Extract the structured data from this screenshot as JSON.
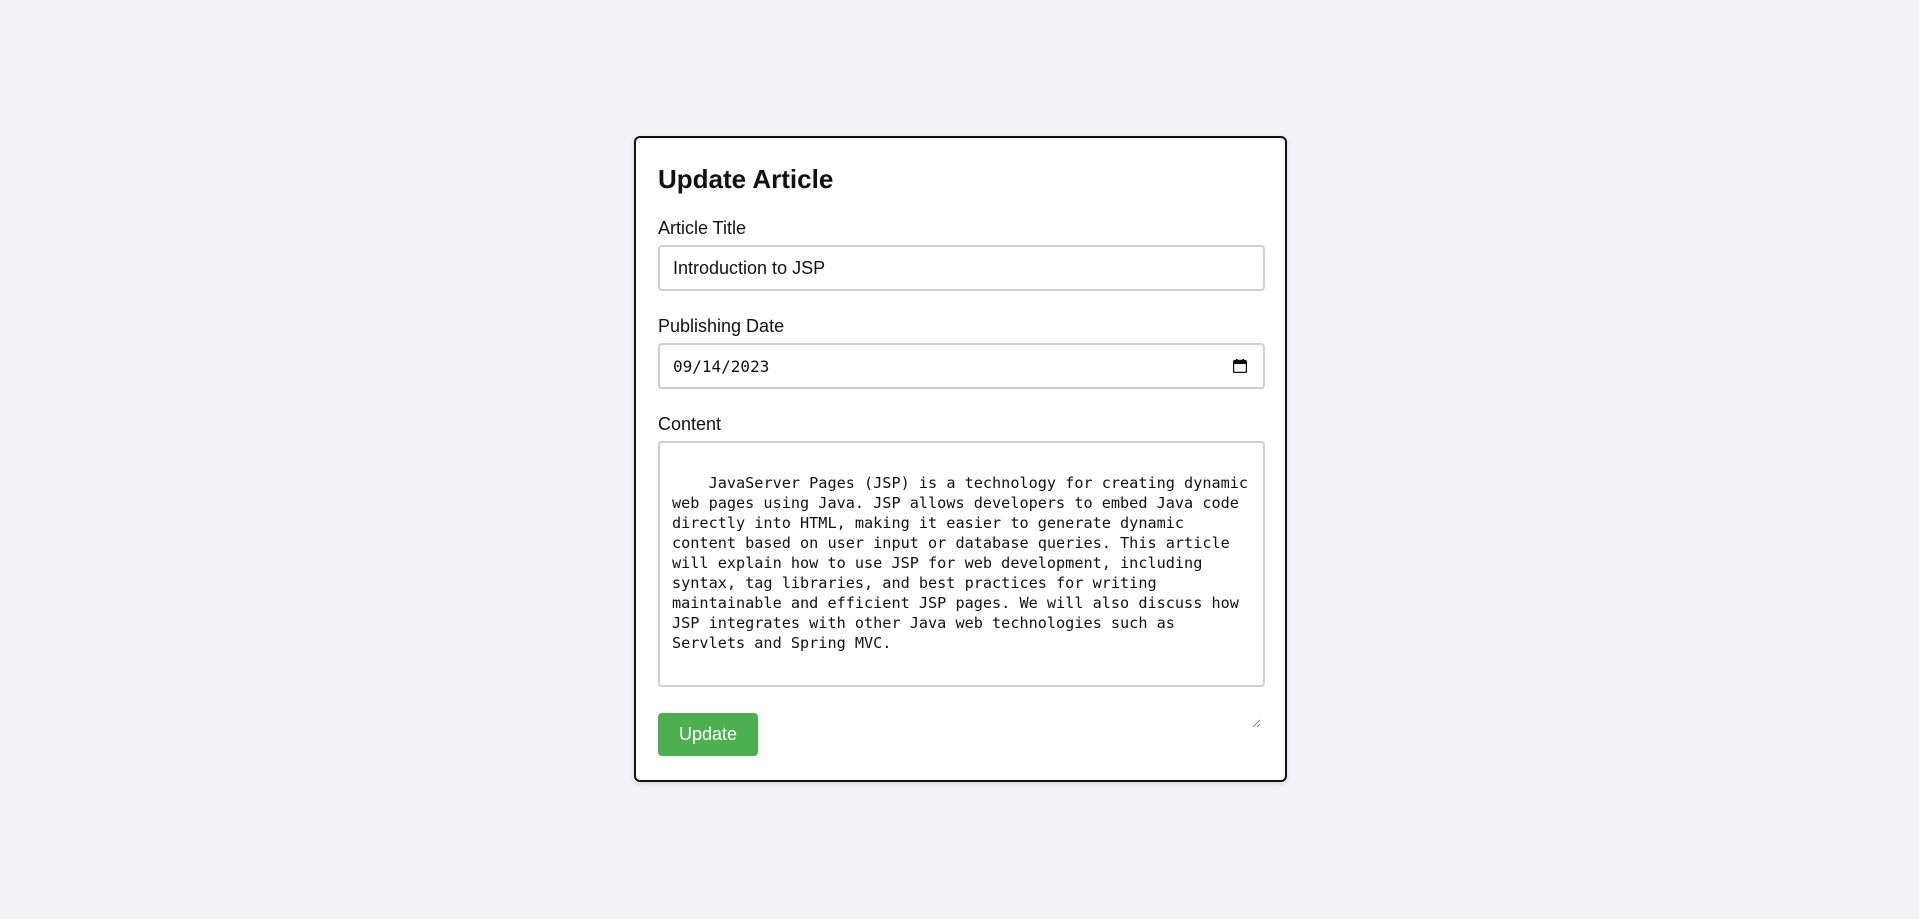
{
  "form": {
    "heading": "Update Article",
    "title_label": "Article Title",
    "title_value": "Introduction to JSP",
    "date_label": "Publishing Date",
    "date_value": "09/14/2023",
    "content_label": "Content",
    "content_value": "JavaServer Pages (JSP) is a technology for creating dynamic web pages using Java. JSP allows developers to embed Java code directly into HTML, making it easier to generate dynamic content based on user input or database queries. This article will explain how to use JSP for web development, including syntax, tag libraries, and best practices for writing maintainable and efficient JSP pages. We will also discuss how JSP integrates with other Java web technologies such as Servlets and Spring MVC.",
    "submit_label": "Update",
    "icons": {
      "date_picker": "calendar-icon",
      "textarea_resize": "resize-grip-icon"
    },
    "colors": {
      "submit_button": "#4caf50",
      "background": "#f4f4f8"
    }
  }
}
